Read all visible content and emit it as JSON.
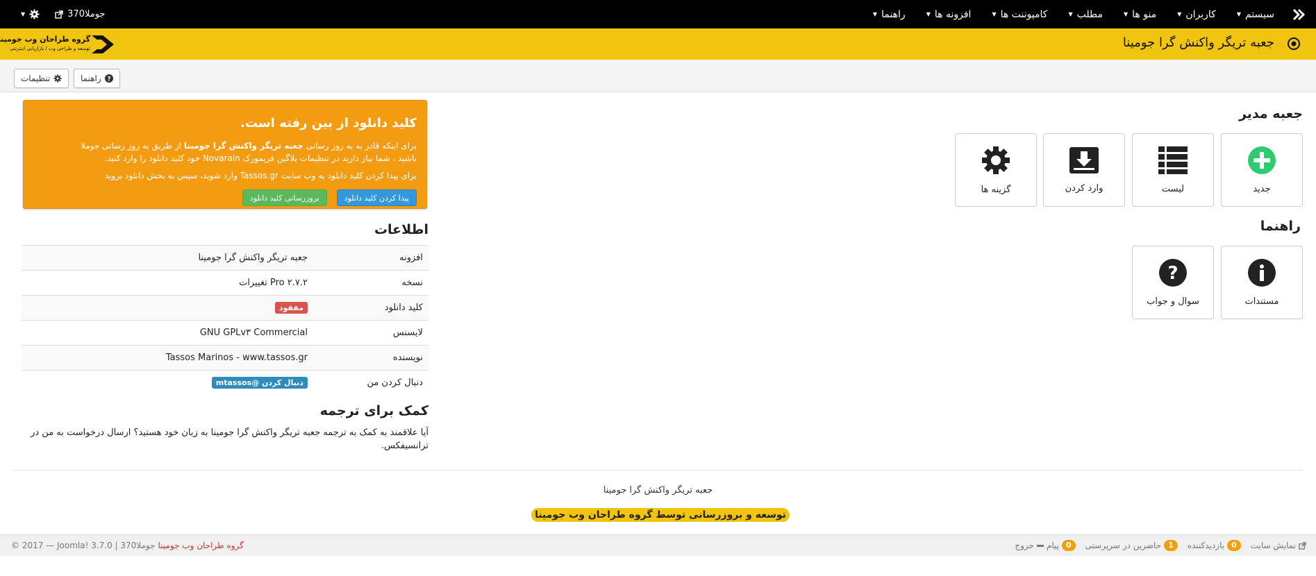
{
  "navbar": {
    "menu": [
      "سیستم",
      "کاربران",
      "منو ها",
      "مطلب",
      "کامپوننت ها",
      "افزونه ها",
      "راهنما"
    ],
    "site_link": "جوملا370"
  },
  "header": {
    "title": "جعبه تریگر واکنش گرا جومینا",
    "logo_title": "گروه طراحان وب جومینا",
    "logo_subtitle": "توسعه و طراحی وب / بازاریابی اینترنتی"
  },
  "toolbar": {
    "help_label": "راهنما",
    "options_label": "تنظیمات"
  },
  "admin_box": {
    "title": "جعبه مدیر",
    "tiles": [
      {
        "label": "جدید",
        "icon": "plus-circle-icon"
      },
      {
        "label": "لیست",
        "icon": "list-icon"
      },
      {
        "label": "وارد کردن",
        "icon": "import-box-icon"
      },
      {
        "label": "گزینه ها",
        "icon": "gear-icon"
      }
    ]
  },
  "help_box": {
    "title": "راهنما",
    "tiles": [
      {
        "label": "مستندات",
        "icon": "info-circle-icon"
      },
      {
        "label": "سوال و جواب",
        "icon": "question-circle-icon"
      }
    ]
  },
  "alert": {
    "title": "کلید دانلود از بین رفته است.",
    "p1_before": "برای اینکه قادر به به روز رسانی ",
    "p1_bold": "جعبه تریگر واکنش گرا جومینا",
    "p1_after": " از طریق به روز رسانی جوملا",
    "p1_line2": "باشید ، شما نیاز دارید در تنظیمات پلاگین فریمورک Novarain خود کلید دانلود را وارد کنید.",
    "p2": "برای پیدا کردن کلید دانلود به وب سایت Tassos.gr وارد شوید، سپس به بخش دانلود بروید",
    "find_key_button": "پیدا کردن کلید دانلود",
    "update_key_button": "بروزرسانی کلید دانلود"
  },
  "info": {
    "title": "اطلاعات",
    "rows": [
      {
        "label": "افزونه",
        "value": "جعبه تریگر واکنش گرا جومینا"
      },
      {
        "label": "نسخه",
        "value": "۲.۷.۲ Pro تغییرات"
      },
      {
        "label": "کلید دانلود",
        "badge": "مفقود"
      },
      {
        "label": "لایسنس",
        "value": "GNU GPLv۳ Commercial"
      },
      {
        "label": "نویسنده",
        "value": "Tassos Marinos - www.tassos.gr"
      },
      {
        "label": "دنبال کردن من",
        "badge": "دنبال کردن @mtassos"
      }
    ]
  },
  "translate": {
    "title": "کمک برای ترجمه",
    "text": "آیا علاقمند به کمک به ترجمه جعبه تریگر واکنش گرا جومینا به زبان خود هستید؟ ارسال درخواست به من در ترانسیفکس."
  },
  "footer": {
    "text": "جعبه تریگر واکنش گرا جومینا",
    "credit": "توسعه و بروزرسانی توسط گروه طراحان وب جومینا"
  },
  "statusbar": {
    "view_site": "نمایش سایت",
    "visitors_count": "0",
    "visitors_label": "بازدیدکننده",
    "admins_count": "1",
    "admins_label": "حاضرین در سرپرستی",
    "messages_count": "0",
    "messages_label": "پیام",
    "logout": "خروج",
    "copyright": "© 2017 — Joomla! 3.7.0 | جوملا370",
    "brand": "گروه طراحان وب جومینا"
  },
  "colors": {
    "brand_yellow": "#f1c40f",
    "alert_orange": "#f39c12",
    "button_blue": "#3498db",
    "button_green": "#5cb85c",
    "badge_red": "#d9534f",
    "badge_blue": "#2d8bbd"
  }
}
